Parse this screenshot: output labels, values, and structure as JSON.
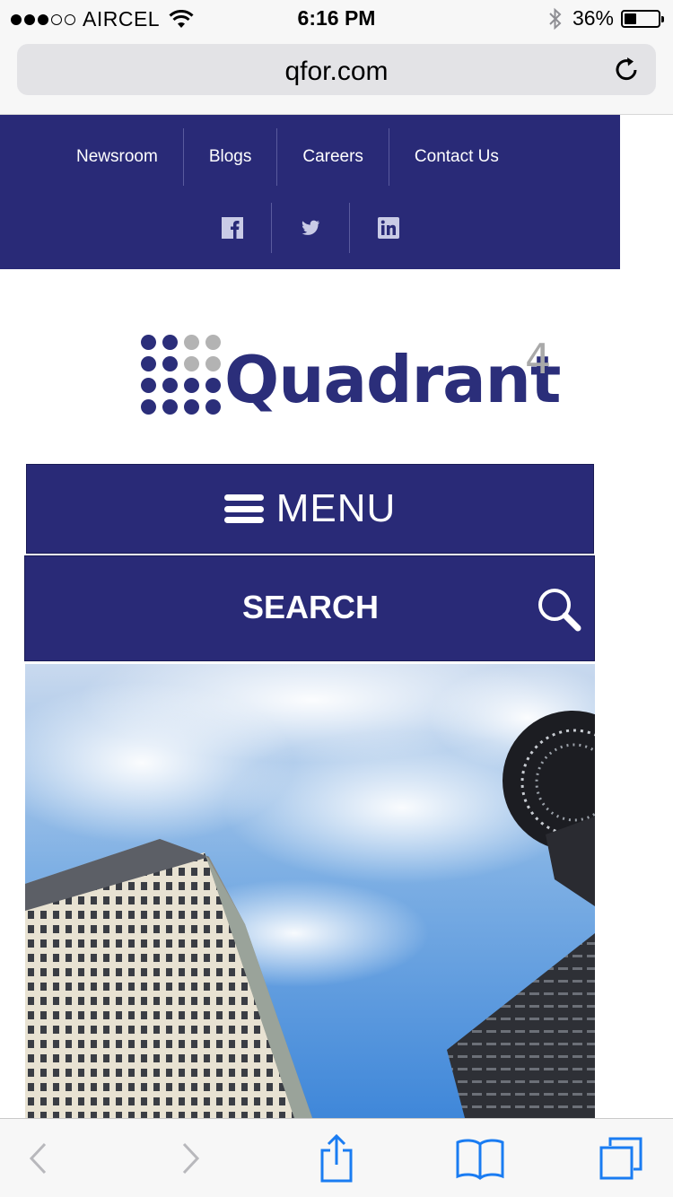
{
  "status_bar": {
    "carrier": "AIRCEL",
    "time": "6:16 PM",
    "battery": "36%",
    "battery_level": 0.36
  },
  "browser": {
    "url": "qfor.com"
  },
  "top_nav": {
    "links": [
      "Newsroom",
      "Blogs",
      "Careers",
      "Contact Us"
    ],
    "social": [
      "facebook-icon",
      "twitter-icon",
      "linkedin-icon"
    ]
  },
  "logo": {
    "text": "Quadrant",
    "superscript": "4"
  },
  "menu": {
    "label": "MENU"
  },
  "search": {
    "label": "SEARCH"
  },
  "colors": {
    "brand": "#292a77",
    "link_active": "#1a7cf2"
  }
}
